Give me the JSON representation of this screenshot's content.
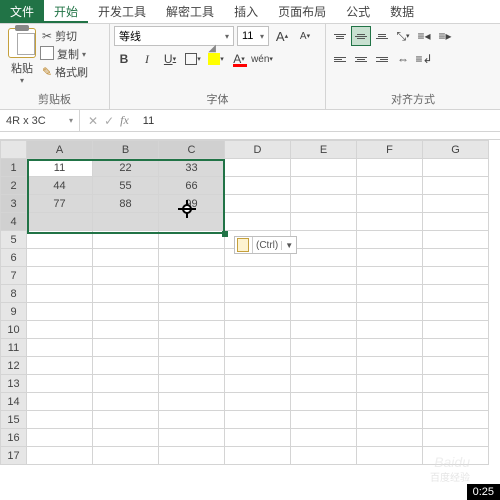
{
  "tabs": {
    "file": "文件",
    "home": "开始",
    "dev": "开发工具",
    "decrypt": "解密工具",
    "insert": "插入",
    "layout": "页面布局",
    "formula": "公式",
    "data": "数据"
  },
  "clipboard": {
    "paste": "粘贴",
    "cut": "剪切",
    "copy": "复制",
    "format_painter": "格式刷",
    "group_label": "剪贴板"
  },
  "font": {
    "name": "等线",
    "size": "11",
    "bold": "B",
    "italic": "I",
    "underline": "U",
    "color_letter": "A",
    "pinyin": "wén",
    "grow": "A",
    "shrink": "A",
    "group_label": "字体"
  },
  "align": {
    "group_label": "对齐方式"
  },
  "formula_bar": {
    "name_box": "4R x 3C",
    "fx": "fx",
    "value": "11"
  },
  "columns": [
    "A",
    "B",
    "C",
    "D",
    "E",
    "F",
    "G"
  ],
  "rows": [
    "1",
    "2",
    "3",
    "4",
    "5",
    "6",
    "7",
    "8",
    "9",
    "10",
    "11",
    "12",
    "13",
    "14",
    "15",
    "16",
    "17"
  ],
  "cells": {
    "r1": [
      "11",
      "22",
      "33"
    ],
    "r2": [
      "44",
      "55",
      "66"
    ],
    "r3": [
      "77",
      "88",
      "99"
    ]
  },
  "smarttag": {
    "label": "(Ctrl)"
  },
  "timestamp": "0:25",
  "chart_data": {
    "type": "table",
    "columns": [
      "A",
      "B",
      "C"
    ],
    "rows": [
      [
        11,
        22,
        33
      ],
      [
        44,
        55,
        66
      ],
      [
        77,
        88,
        99
      ]
    ]
  }
}
